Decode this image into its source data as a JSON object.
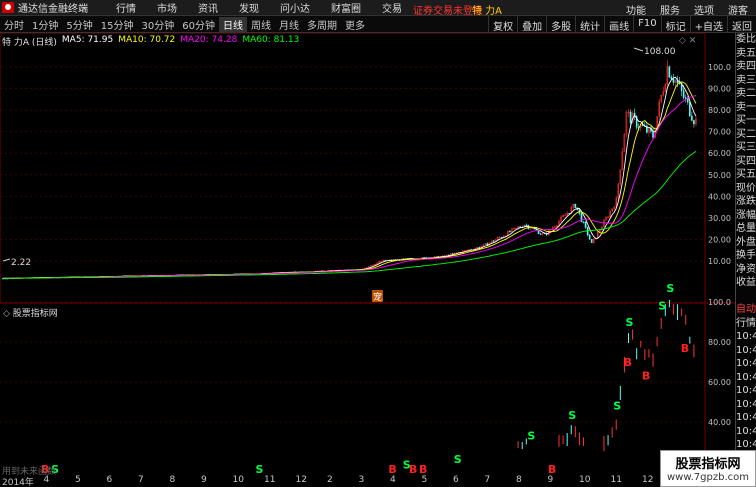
{
  "app": {
    "title": "通达信金融终端"
  },
  "menu": [
    "行情",
    "市场",
    "资讯",
    "发现",
    "问小达",
    "财富圈",
    "交易"
  ],
  "login_status": "证券交易未登录",
  "stock_top": "特 力A",
  "top_right": [
    "功能",
    "服务",
    "选项",
    "游客"
  ],
  "periods": [
    "分时",
    "1分钟",
    "5分钟",
    "15分钟",
    "30分钟",
    "60分钟",
    "日线",
    "周线",
    "月线",
    "多周期",
    "更多"
  ],
  "active_period": "日线",
  "right_tools": [
    "复权",
    "叠加",
    "多股",
    "统计",
    "画线",
    "F10",
    "标记",
    "+自选",
    "返回"
  ],
  "info": {
    "name": "特 力A (日线)",
    "ma5": "MA5: 71.95",
    "ma10": "MA10: 70.72",
    "ma20": "MA20: 74.28",
    "ma60": "MA60: 81.13"
  },
  "quote_col": [
    "委比",
    "卖五",
    "卖四",
    "卖三",
    "卖二",
    "卖一",
    "买一",
    "买二",
    "买三",
    "买四",
    "买五",
    "现价",
    "涨跌",
    "涨幅",
    "总量",
    "外盘",
    "换手",
    "净资",
    "收益",
    "",
    "自动",
    "行情",
    "10:40",
    "10:40",
    "10:40",
    "10:40",
    "10:40",
    "10:40",
    "10:40",
    "10:40",
    "10:40",
    "10:40"
  ],
  "axis_main": [
    "100.0",
    "90.00",
    "80.00",
    "70.00",
    "60.00",
    "50.00",
    "40.00",
    "30.00",
    "20.00",
    "10.00"
  ],
  "axis_sub": [
    "100.0",
    "80.00",
    "60.00",
    "40.00"
  ],
  "price_high_label": "108.00",
  "price_low_label": "2.22",
  "flag_label": "宠",
  "sub_title": "股票指标网",
  "hint": "用到未来函数",
  "dates": [
    "2014年",
    "4",
    "5",
    "6",
    "7",
    "8",
    "9",
    "10",
    "11",
    "12",
    "2",
    "3",
    "4",
    "5",
    "6",
    "7",
    "8",
    "9",
    "10",
    "11",
    "12"
  ],
  "watermark": {
    "title": "股票指标网",
    "url": "www.7gpzb.com"
  },
  "signals": {
    "buy": "B",
    "sell": "S"
  },
  "colors": {
    "up": "#ff3232",
    "down": "#54ffff",
    "ma5": "#ffffff",
    "ma10": "#ffff00",
    "ma20": "#ff00ff",
    "ma60": "#00ff00",
    "buy": "#ff2020",
    "sell": "#00ff40"
  }
}
